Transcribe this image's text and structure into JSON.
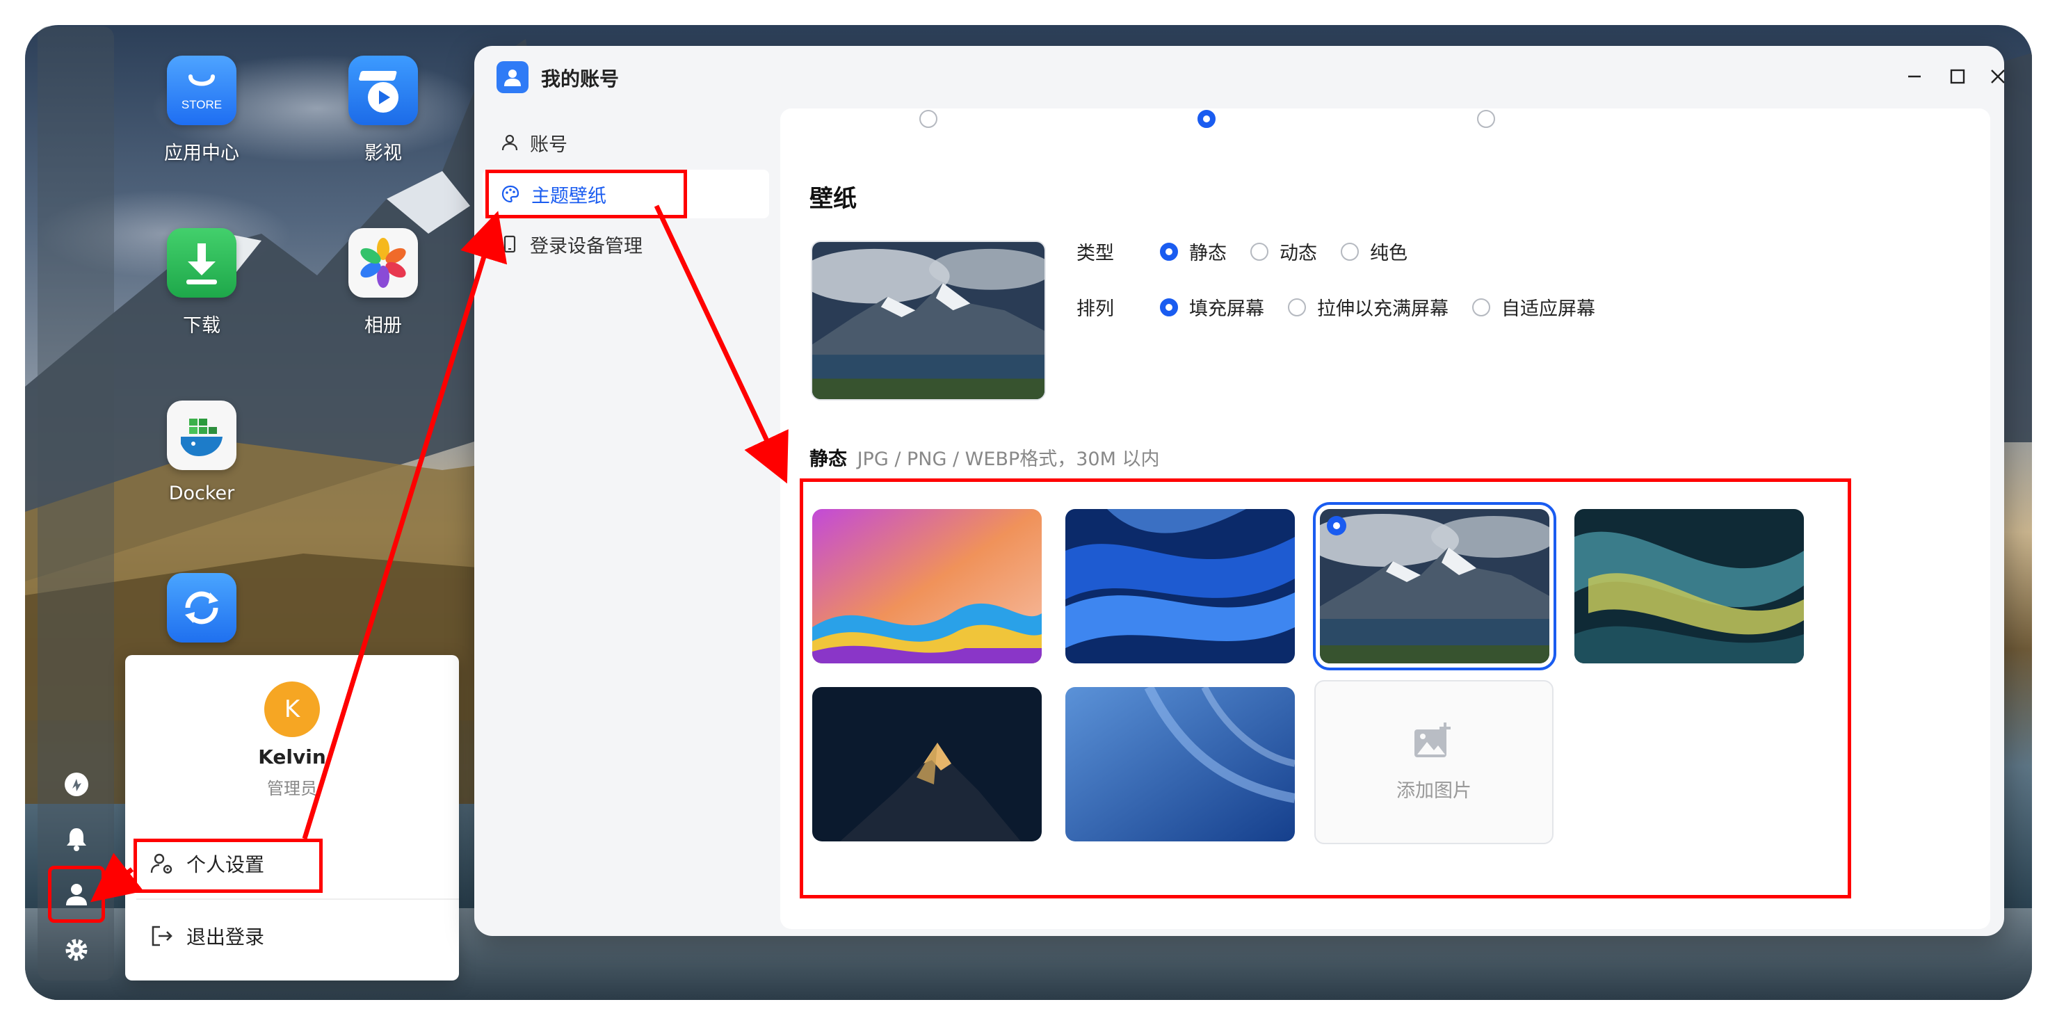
{
  "desktop": {
    "apps": [
      {
        "name": "应用中心",
        "icon": "store-icon",
        "badge": "STORE"
      },
      {
        "name": "影视",
        "icon": "video-icon"
      },
      {
        "name": "下载",
        "icon": "download-icon"
      },
      {
        "name": "相册",
        "icon": "photos-icon"
      },
      {
        "name": "Docker",
        "icon": "docker-icon"
      },
      {
        "name": "",
        "icon": "sync-icon"
      }
    ]
  },
  "dock": {
    "items": [
      "speed-icon",
      "bell-icon",
      "user-icon",
      "gear-icon"
    ]
  },
  "user_menu": {
    "avatar_letter": "K",
    "name": "Kelvin",
    "role": "管理员",
    "personal_settings": "个人设置",
    "logout": "退出登录"
  },
  "window": {
    "title": "我的账号",
    "sidebar": [
      {
        "label": "账号",
        "icon": "user-icon"
      },
      {
        "label": "主题壁纸",
        "icon": "palette-icon"
      },
      {
        "label": "登录设备管理",
        "icon": "phone-icon"
      }
    ],
    "wallpaper": {
      "heading": "壁纸",
      "type_label": "类型",
      "type_options": [
        "静态",
        "动态",
        "纯色"
      ],
      "type_selected": "静态",
      "layout_label": "排列",
      "layout_options": [
        "填充屏幕",
        "拉伸以充满屏幕",
        "自适应屏幕"
      ],
      "layout_selected": "填充屏幕",
      "static_label": "静态",
      "format_hint": "JPG / PNG / WEBP格式，30M 以内",
      "add_image": "添加图片"
    }
  },
  "colors": {
    "accent": "#1a5cf0",
    "annotation": "#ff0000",
    "avatar": "#f6a623"
  }
}
